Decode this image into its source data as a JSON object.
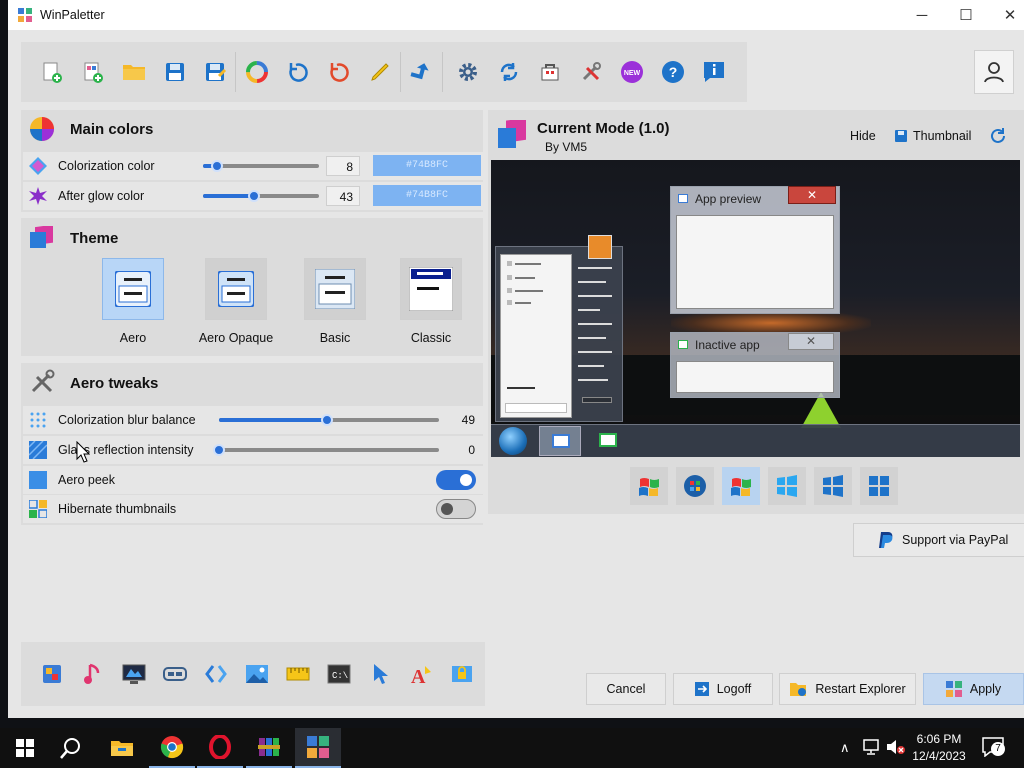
{
  "window": {
    "title": "WinPaletter",
    "minimize": "─",
    "maximize": "☐",
    "close": "✕"
  },
  "toolbar": {
    "icons": [
      "new-theme-icon",
      "new-from-current-icon",
      "open-folder-icon",
      "save-icon",
      "save-as-icon",
      "color-wheel-icon",
      "undo-icon",
      "reset-icon",
      "edit-pencil-icon",
      "apply-arrow-icon",
      "settings-gear-icon",
      "sync-icon",
      "store-icon",
      "tools-icon",
      "whats-new-icon",
      "help-icon",
      "about-info-icon"
    ],
    "new_badge": "NEW"
  },
  "main_colors": {
    "title": "Main colors",
    "colorization": {
      "label": "Colorization color",
      "value": "8",
      "hex": "#74B8FC",
      "level": 0.12
    },
    "afterglow": {
      "label": "After glow color",
      "value": "43",
      "hex": "#74B8FC",
      "level": 0.44
    }
  },
  "theme": {
    "title": "Theme",
    "options": [
      {
        "label": "Aero",
        "selected": true
      },
      {
        "label": "Aero Opaque",
        "selected": false
      },
      {
        "label": "Basic",
        "selected": false
      },
      {
        "label": "Classic",
        "selected": false
      }
    ]
  },
  "aero_tweaks": {
    "title": "Aero tweaks",
    "blur": {
      "label": "Colorization blur balance",
      "value": "49",
      "level": 0.49
    },
    "glass": {
      "label": "Glass reflection intensity",
      "value": "0",
      "level": 0.0
    },
    "peek": {
      "label": "Aero peek",
      "on": true
    },
    "hibernate": {
      "label": "Hibernate thumbnails",
      "on": false
    }
  },
  "preview": {
    "title": "Current Mode (1.0)",
    "author": "By VM5",
    "hide": "Hide",
    "thumbnail": "Thumbnail",
    "active_window": "App preview",
    "inactive_window": "Inactive app",
    "os_versions": [
      "Windows XP",
      "Windows 7",
      "Windows Vista",
      "Windows 8",
      "Windows 8.1",
      "Windows 10"
    ]
  },
  "paypal": "Support via PayPal",
  "bottom_buttons": {
    "cancel": "Cancel",
    "logoff": "Logoff",
    "restart": "Restart Explorer",
    "apply": "Apply"
  },
  "colors": {
    "accent": "#2a6fd6",
    "colorbox": "#7db3f2"
  },
  "taskbar": {
    "time": "6:06 PM",
    "date": "12/4/2023",
    "notification_count": "7",
    "apps": [
      "start-icon",
      "search-icon",
      "file-explorer-icon",
      "chrome-icon",
      "opera-icon",
      "winrar-icon",
      "winpaletter-icon"
    ]
  }
}
